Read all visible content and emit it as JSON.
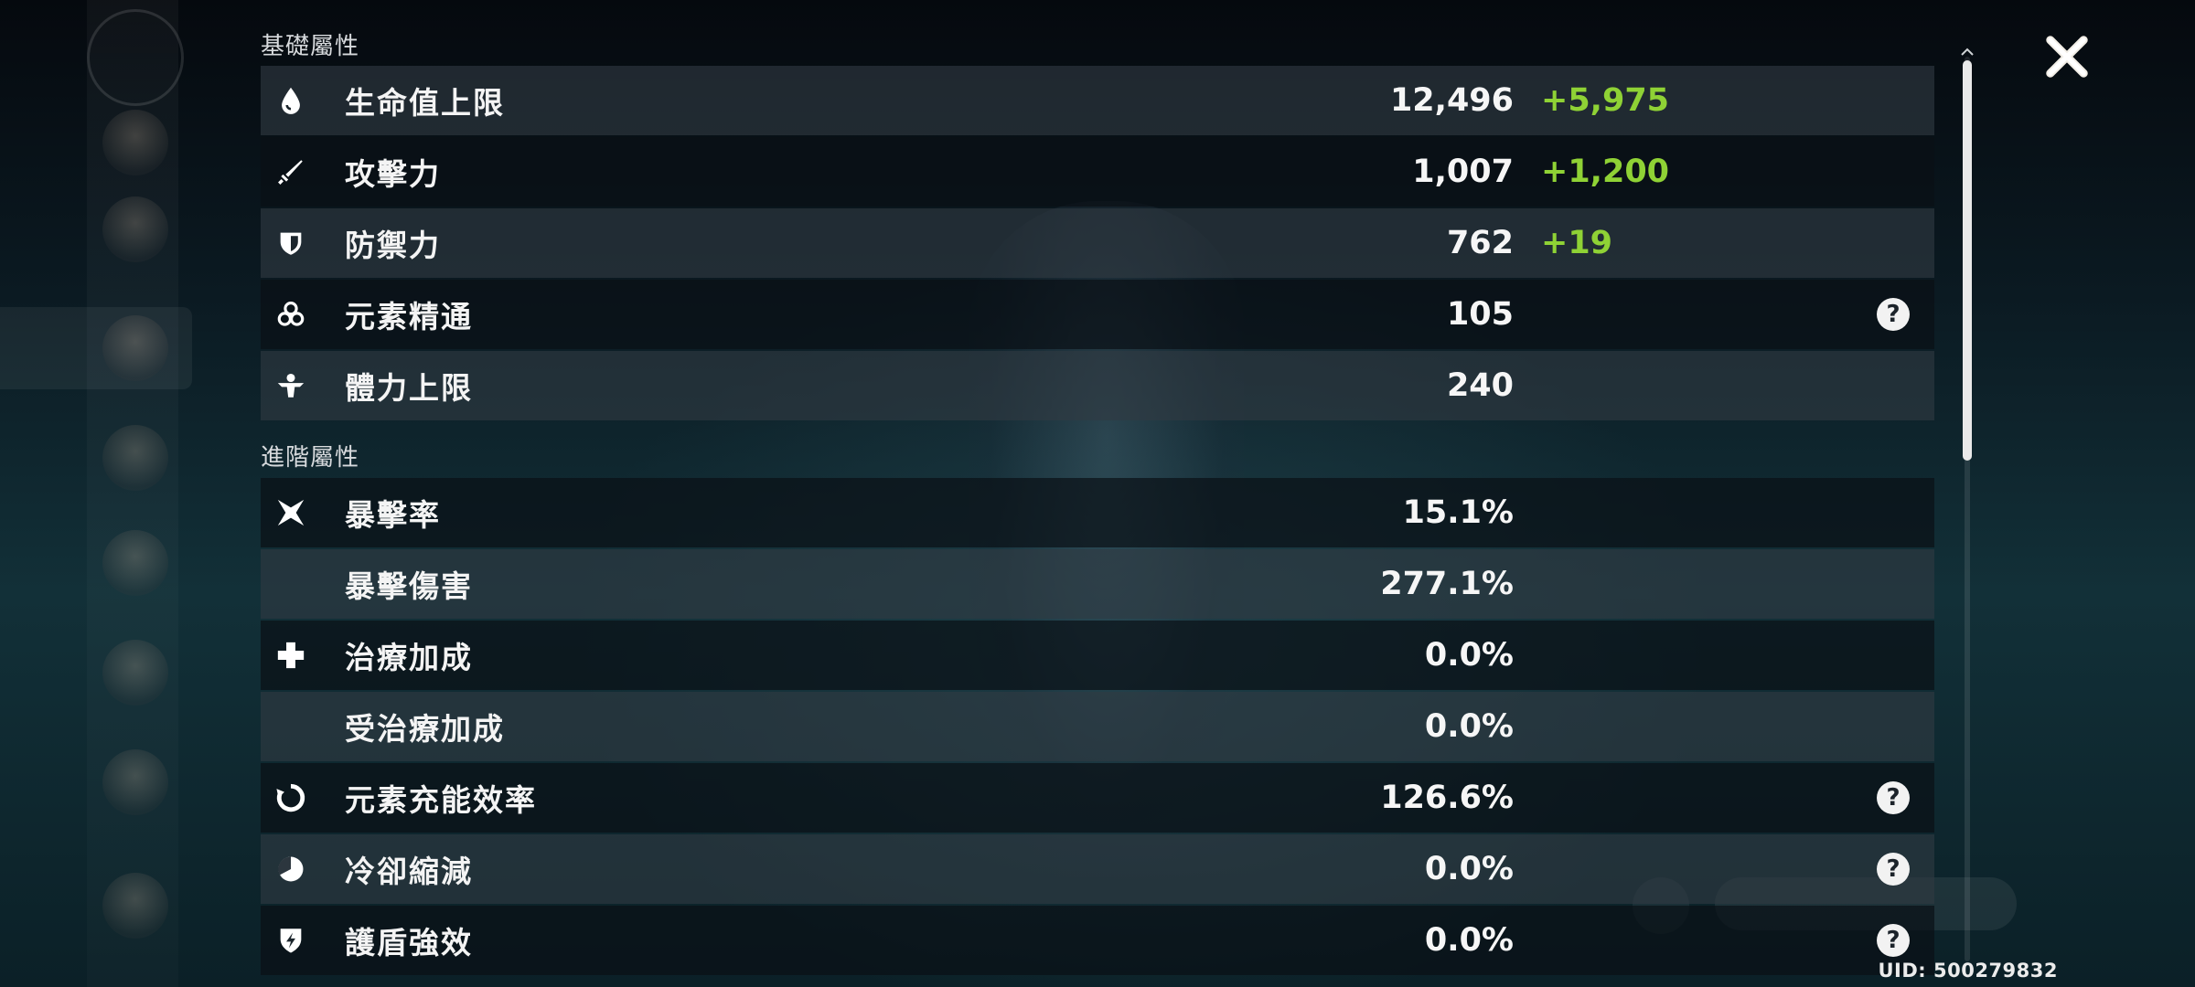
{
  "sections": {
    "basic_title": "基礎屬性",
    "advanced_title": "進階屬性"
  },
  "basic_stats": [
    {
      "icon": "hp-droplet-icon",
      "label": "生命值上限",
      "value": "12,496",
      "bonus": "+5,975",
      "help": false
    },
    {
      "icon": "atk-sword-icon",
      "label": "攻擊力",
      "value": "1,007",
      "bonus": "+1,200",
      "help": false
    },
    {
      "icon": "def-shield-icon",
      "label": "防禦力",
      "value": "762",
      "bonus": "+19",
      "help": false
    },
    {
      "icon": "elemental-mastery-icon",
      "label": "元素精通",
      "value": "105",
      "bonus": "",
      "help": true
    },
    {
      "icon": "stamina-icon",
      "label": "體力上限",
      "value": "240",
      "bonus": "",
      "help": false
    }
  ],
  "advanced_stats": [
    {
      "icon": "crit-rate-icon",
      "label": "暴擊率",
      "value": "15.1%",
      "help": false
    },
    {
      "icon": "",
      "label": "暴擊傷害",
      "value": "277.1%",
      "help": false
    },
    {
      "icon": "healing-bonus-icon",
      "label": "治療加成",
      "value": "0.0%",
      "help": false
    },
    {
      "icon": "",
      "label": "受治療加成",
      "value": "0.0%",
      "help": false
    },
    {
      "icon": "energy-recharge-icon",
      "label": "元素充能效率",
      "value": "126.6%",
      "help": true
    },
    {
      "icon": "cd-reduction-icon",
      "label": "冷卻縮減",
      "value": "0.0%",
      "help": true
    },
    {
      "icon": "shield-strength-icon",
      "label": "護盾強效",
      "value": "0.0%",
      "help": true
    }
  ],
  "help_glyph": "?",
  "uid": "UID: 500279832",
  "colors": {
    "bonus": "#8fd235",
    "row_dark": "#0a1016",
    "row_light": "#303a42"
  }
}
